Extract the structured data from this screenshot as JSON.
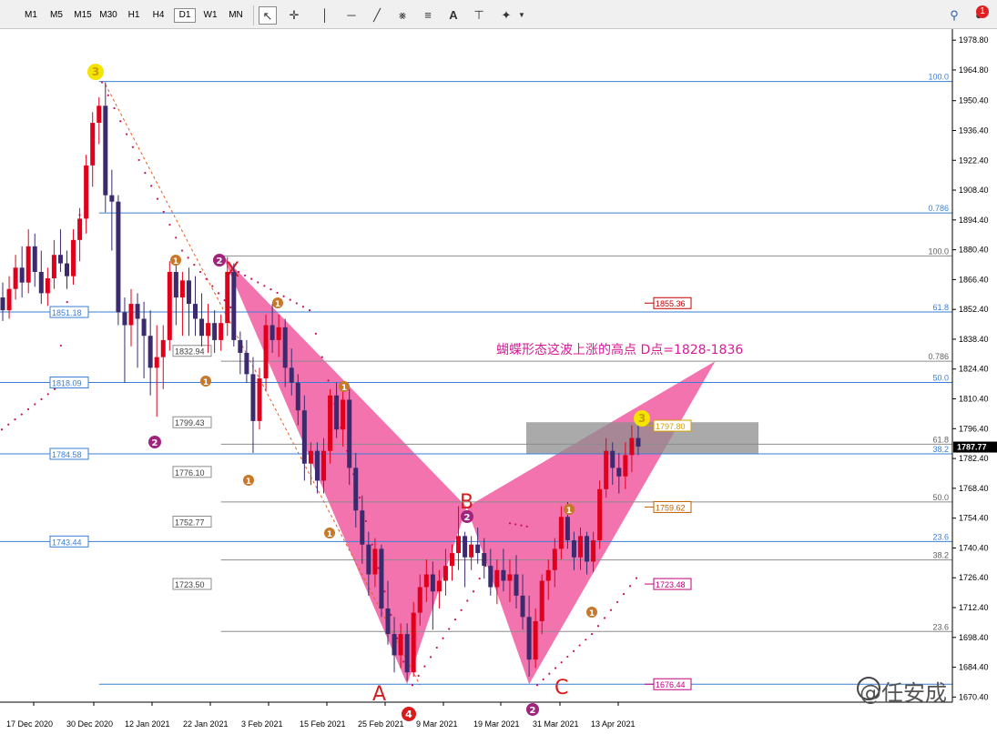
{
  "toolbar": {
    "timeframes": [
      "M1",
      "M5",
      "M15",
      "M30",
      "H1",
      "H4",
      "D1",
      "W1",
      "MN"
    ],
    "active_timeframe": "D1",
    "tools": [
      "cursor-icon",
      "crosshair-icon",
      "vertical-line-icon",
      "horizontal-line-icon",
      "trendline-icon",
      "fibonacci-channel-icon",
      "fibonacci-fan-icon",
      "text-icon",
      "text-label-icon",
      "shapes-icon"
    ],
    "notification_count": "1"
  },
  "chart_data": {
    "type": "candlestick",
    "price_axis": {
      "ticks": [
        "1978.80",
        "1964.80",
        "1950.40",
        "1936.40",
        "1922.40",
        "1908.40",
        "1894.40",
        "1880.40",
        "1866.40",
        "1852.40",
        "1838.40",
        "1824.40",
        "1810.40",
        "1796.40",
        "1782.40",
        "1768.40",
        "1754.40",
        "1740.40",
        "1726.40",
        "1712.40",
        "1698.40",
        "1684.40",
        "1670.40"
      ],
      "ylim": [
        1668,
        1984
      ],
      "current_price": "1787.77"
    },
    "time_axis": {
      "labels": [
        "17 Dec 2020",
        "30 Dec 2020",
        "12 Jan 2021",
        "22 Jan 2021",
        "3 Feb 2021",
        "15 Feb 2021",
        "25 Feb 2021",
        "9 Mar 2021",
        "19 Mar 2021",
        "31 Mar 2021",
        "13 Apr 2021"
      ]
    },
    "candles": [
      [
        1858,
        1865,
        1847,
        1852
      ],
      [
        1852,
        1868,
        1848,
        1862
      ],
      [
        1862,
        1878,
        1857,
        1872
      ],
      [
        1872,
        1882,
        1858,
        1865
      ],
      [
        1865,
        1890,
        1860,
        1882
      ],
      [
        1882,
        1888,
        1863,
        1870
      ],
      [
        1870,
        1880,
        1855,
        1860
      ],
      [
        1860,
        1872,
        1854,
        1867
      ],
      [
        1867,
        1885,
        1862,
        1878
      ],
      [
        1878,
        1890,
        1870,
        1874
      ],
      [
        1874,
        1880,
        1862,
        1868
      ],
      [
        1868,
        1890,
        1864,
        1885
      ],
      [
        1885,
        1900,
        1875,
        1895
      ],
      [
        1895,
        1925,
        1888,
        1920
      ],
      [
        1920,
        1945,
        1910,
        1940
      ],
      [
        1940,
        1952,
        1930,
        1948
      ],
      [
        1948,
        1959,
        1898,
        1906
      ],
      [
        1906,
        1918,
        1880,
        1903
      ],
      [
        1903,
        1906,
        1845,
        1851
      ],
      [
        1851,
        1858,
        1818,
        1845
      ],
      [
        1845,
        1862,
        1835,
        1855
      ],
      [
        1855,
        1860,
        1825,
        1848
      ],
      [
        1848,
        1856,
        1820,
        1840
      ],
      [
        1840,
        1852,
        1812,
        1825
      ],
      [
        1825,
        1845,
        1802,
        1830
      ],
      [
        1830,
        1845,
        1815,
        1838
      ],
      [
        1838,
        1875,
        1833,
        1870
      ],
      [
        1870,
        1875,
        1845,
        1858
      ],
      [
        1858,
        1870,
        1840,
        1866
      ],
      [
        1866,
        1872,
        1840,
        1855
      ],
      [
        1855,
        1868,
        1840,
        1848
      ],
      [
        1848,
        1860,
        1835,
        1840
      ],
      [
        1840,
        1855,
        1832,
        1846
      ],
      [
        1846,
        1852,
        1832,
        1838
      ],
      [
        1838,
        1850,
        1833,
        1846
      ],
      [
        1846,
        1877,
        1840,
        1870
      ],
      [
        1870,
        1874,
        1835,
        1838
      ],
      [
        1838,
        1842,
        1822,
        1832
      ],
      [
        1832,
        1838,
        1818,
        1822
      ],
      [
        1822,
        1830,
        1785,
        1800
      ],
      [
        1800,
        1825,
        1796,
        1820
      ],
      [
        1820,
        1850,
        1814,
        1845
      ],
      [
        1845,
        1855,
        1832,
        1838
      ],
      [
        1838,
        1850,
        1830,
        1844
      ],
      [
        1844,
        1848,
        1816,
        1825
      ],
      [
        1825,
        1834,
        1812,
        1818
      ],
      [
        1818,
        1822,
        1798,
        1805
      ],
      [
        1805,
        1812,
        1772,
        1780
      ],
      [
        1780,
        1790,
        1770,
        1786
      ],
      [
        1786,
        1790,
        1766,
        1772
      ],
      [
        1772,
        1792,
        1766,
        1786
      ],
      [
        1786,
        1815,
        1780,
        1812
      ],
      [
        1812,
        1818,
        1792,
        1796
      ],
      [
        1796,
        1816,
        1788,
        1810
      ],
      [
        1810,
        1815,
        1770,
        1778
      ],
      [
        1778,
        1785,
        1750,
        1758
      ],
      [
        1758,
        1765,
        1733,
        1742
      ],
      [
        1742,
        1748,
        1718,
        1728
      ],
      [
        1728,
        1745,
        1722,
        1740
      ],
      [
        1740,
        1742,
        1708,
        1712
      ],
      [
        1712,
        1725,
        1695,
        1700
      ],
      [
        1700,
        1708,
        1682,
        1690
      ],
      [
        1690,
        1705,
        1684,
        1700
      ],
      [
        1700,
        1705,
        1678,
        1682
      ],
      [
        1682,
        1715,
        1680,
        1710
      ],
      [
        1710,
        1728,
        1704,
        1722
      ],
      [
        1722,
        1735,
        1715,
        1728
      ],
      [
        1728,
        1734,
        1702,
        1720
      ],
      [
        1720,
        1730,
        1712,
        1725
      ],
      [
        1725,
        1740,
        1718,
        1732
      ],
      [
        1732,
        1742,
        1725,
        1738
      ],
      [
        1738,
        1760,
        1730,
        1746
      ],
      [
        1746,
        1748,
        1722,
        1736
      ],
      [
        1736,
        1746,
        1730,
        1742
      ],
      [
        1742,
        1750,
        1733,
        1738
      ],
      [
        1738,
        1745,
        1726,
        1732
      ],
      [
        1732,
        1740,
        1718,
        1722
      ],
      [
        1722,
        1735,
        1714,
        1730
      ],
      [
        1730,
        1740,
        1720,
        1725
      ],
      [
        1725,
        1735,
        1715,
        1728
      ],
      [
        1728,
        1737,
        1712,
        1718
      ],
      [
        1718,
        1728,
        1702,
        1708
      ],
      [
        1708,
        1718,
        1680,
        1688
      ],
      [
        1688,
        1712,
        1684,
        1706
      ],
      [
        1706,
        1728,
        1700,
        1725
      ],
      [
        1725,
        1735,
        1716,
        1730
      ],
      [
        1730,
        1745,
        1722,
        1740
      ],
      [
        1740,
        1760,
        1735,
        1755
      ],
      [
        1755,
        1762,
        1740,
        1744
      ],
      [
        1744,
        1748,
        1730,
        1736
      ],
      [
        1736,
        1750,
        1730,
        1746
      ],
      [
        1746,
        1748,
        1728,
        1734
      ],
      [
        1734,
        1748,
        1729,
        1744
      ],
      [
        1744,
        1772,
        1740,
        1768
      ],
      [
        1768,
        1792,
        1764,
        1786
      ],
      [
        1786,
        1790,
        1770,
        1778
      ],
      [
        1778,
        1785,
        1766,
        1774
      ],
      [
        1774,
        1790,
        1768,
        1784
      ],
      [
        1784,
        1798,
        1776,
        1792
      ],
      [
        1792,
        1800,
        1784,
        1788
      ]
    ],
    "fibonacci_blue": {
      "levels": [
        {
          "label": "100.0",
          "price": 1959.4
        },
        {
          "label": "0.786",
          "price": 1897.7
        },
        {
          "label": "61.8",
          "price": 1851.18
        },
        {
          "label": "50.0",
          "price": 1818.09
        },
        {
          "label": "38.2",
          "price": 1784.58
        },
        {
          "label": "23.6",
          "price": 1743.44
        }
      ],
      "left_labels": [
        "1851.18",
        "1818.09",
        "1784.58",
        "1743.44"
      ]
    },
    "fibonacci_gray": {
      "levels": [
        {
          "label": "100.0",
          "price": 1877.5
        },
        {
          "label": "0.786",
          "price": 1828.1
        },
        {
          "label": "61.8",
          "price": 1789.1
        },
        {
          "label": "50.0",
          "price": 1762.0
        },
        {
          "label": "38.2",
          "price": 1734.8
        },
        {
          "label": "23.6",
          "price": 1701.2
        }
      ],
      "left_labels": [
        "1832.94",
        "1799.43",
        "1776.10",
        "1752.77",
        "1723.50"
      ]
    },
    "bottom_line": {
      "price": 1676.44,
      "label": "1676.44"
    },
    "right_price_labels": [
      {
        "label": "1855.36",
        "price": 1855.36,
        "color": "#c00000"
      },
      {
        "label": "1797.80",
        "price": 1797.8,
        "color": "#d4a000"
      },
      {
        "label": "1759.62",
        "price": 1759.62,
        "color": "#c06000"
      },
      {
        "label": "1723.48",
        "price": 1723.48,
        "color": "#c0007a"
      },
      {
        "label": "1676.44",
        "price": 1676.44,
        "color": "#c0007a"
      }
    ],
    "butterfly": {
      "points": {
        "X": 1877.5,
        "A": 1676.44,
        "B": 1759.62,
        "C": 1676.44,
        "D": 1828.1
      },
      "labels": [
        "X",
        "A",
        "B",
        "C"
      ],
      "color": "#f05aa0"
    },
    "potential_reversal_zone": {
      "top": 1799.43,
      "bottom": 1784.58
    },
    "annotation": "蝴蝶形态这波上涨的高点 D点=1828-1836",
    "wave_markers": [
      "3",
      "2",
      "1",
      "2",
      "1",
      "1",
      "1",
      "1",
      "1",
      "1",
      "2",
      "1",
      "1",
      "2",
      "3",
      "4"
    ],
    "colors": {
      "bull": "#e0001b",
      "bear": "#3b2a6e",
      "fib_blue": "#3a7fd5",
      "fib_gray": "#8c8c8c",
      "dots": "#c8105a"
    }
  },
  "watermark": "@任安成"
}
